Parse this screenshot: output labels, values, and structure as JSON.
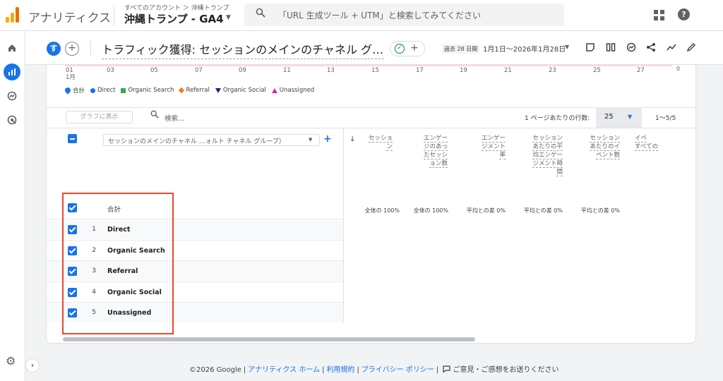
{
  "topbar": {
    "app_name": "アナリティクス",
    "breadcrumb": "すべてのアカウント ＞ 沖縄トランプ",
    "property": "沖縄トランプ - GA4",
    "search_placeholder": "「URL 生成ツール + UTM」と検索してみてください"
  },
  "report": {
    "avatar_letter": "す",
    "title": "トラフィック獲得: セッションのメインのチャネル グループ（デフォルト チャネル グループ）",
    "date_chip": "過去 28 日間",
    "date_range": "1月1日〜2026年1月28日"
  },
  "chart": {
    "x_ticks": [
      "01",
      "03",
      "05",
      "07",
      "09",
      "11",
      "13",
      "15",
      "17",
      "19",
      "21",
      "23",
      "25",
      "27"
    ],
    "x_month": "1月",
    "y_zero": "0",
    "legend": [
      {
        "label": "合計",
        "marker": "pin",
        "color": "#1a73e8"
      },
      {
        "label": "Direct",
        "marker": "circle",
        "color": "#1a73e8"
      },
      {
        "label": "Organic Search",
        "marker": "square",
        "color": "#34a853"
      },
      {
        "label": "Referral",
        "marker": "diamond",
        "color": "#fa7b17"
      },
      {
        "label": "Organic Social",
        "marker": "tri-down",
        "color": "#1a237e"
      },
      {
        "label": "Unassigned",
        "marker": "tri-up",
        "color": "#e52592"
      }
    ]
  },
  "table": {
    "graph_button": "グラフに表示",
    "search_placeholder": "検索...",
    "rows_per_page_label": "1 ページあたりの行数:",
    "rows_per_page_value": "25",
    "pager": "1〜5/5",
    "dimension_select": "セッションのメインのチャネル …ォルト チャネル グループ）",
    "metrics": [
      {
        "header": "セッショ\nン",
        "total": "全体の 100%"
      },
      {
        "header": "エンゲー\nジのあっ\nたセッシ\nョン数",
        "total": "全体の 100%"
      },
      {
        "header": "エンゲー\nジメント\n率",
        "total": "平均との差 0%"
      },
      {
        "header": "セッション\nあたりの平\n均エンゲー\nジメント時\n間",
        "total": "平均との差 0%"
      },
      {
        "header": "セッション\nあたりのイ\nベント数",
        "total": "平均との差 0%"
      },
      {
        "header": "イベ\nすべての",
        "total": ""
      }
    ],
    "total_label": "合計",
    "rows": [
      {
        "num": "1",
        "label": "Direct"
      },
      {
        "num": "2",
        "label": "Organic Search"
      },
      {
        "num": "3",
        "label": "Referral"
      },
      {
        "num": "4",
        "label": "Organic Social"
      },
      {
        "num": "5",
        "label": "Unassigned"
      }
    ]
  },
  "footer": {
    "copyright": "©2026 Google",
    "links": [
      "アナリティクス ホーム",
      "利用規約",
      "プライバシー ポリシー"
    ],
    "feedback": "ご意見・ご感想をお送りください"
  }
}
